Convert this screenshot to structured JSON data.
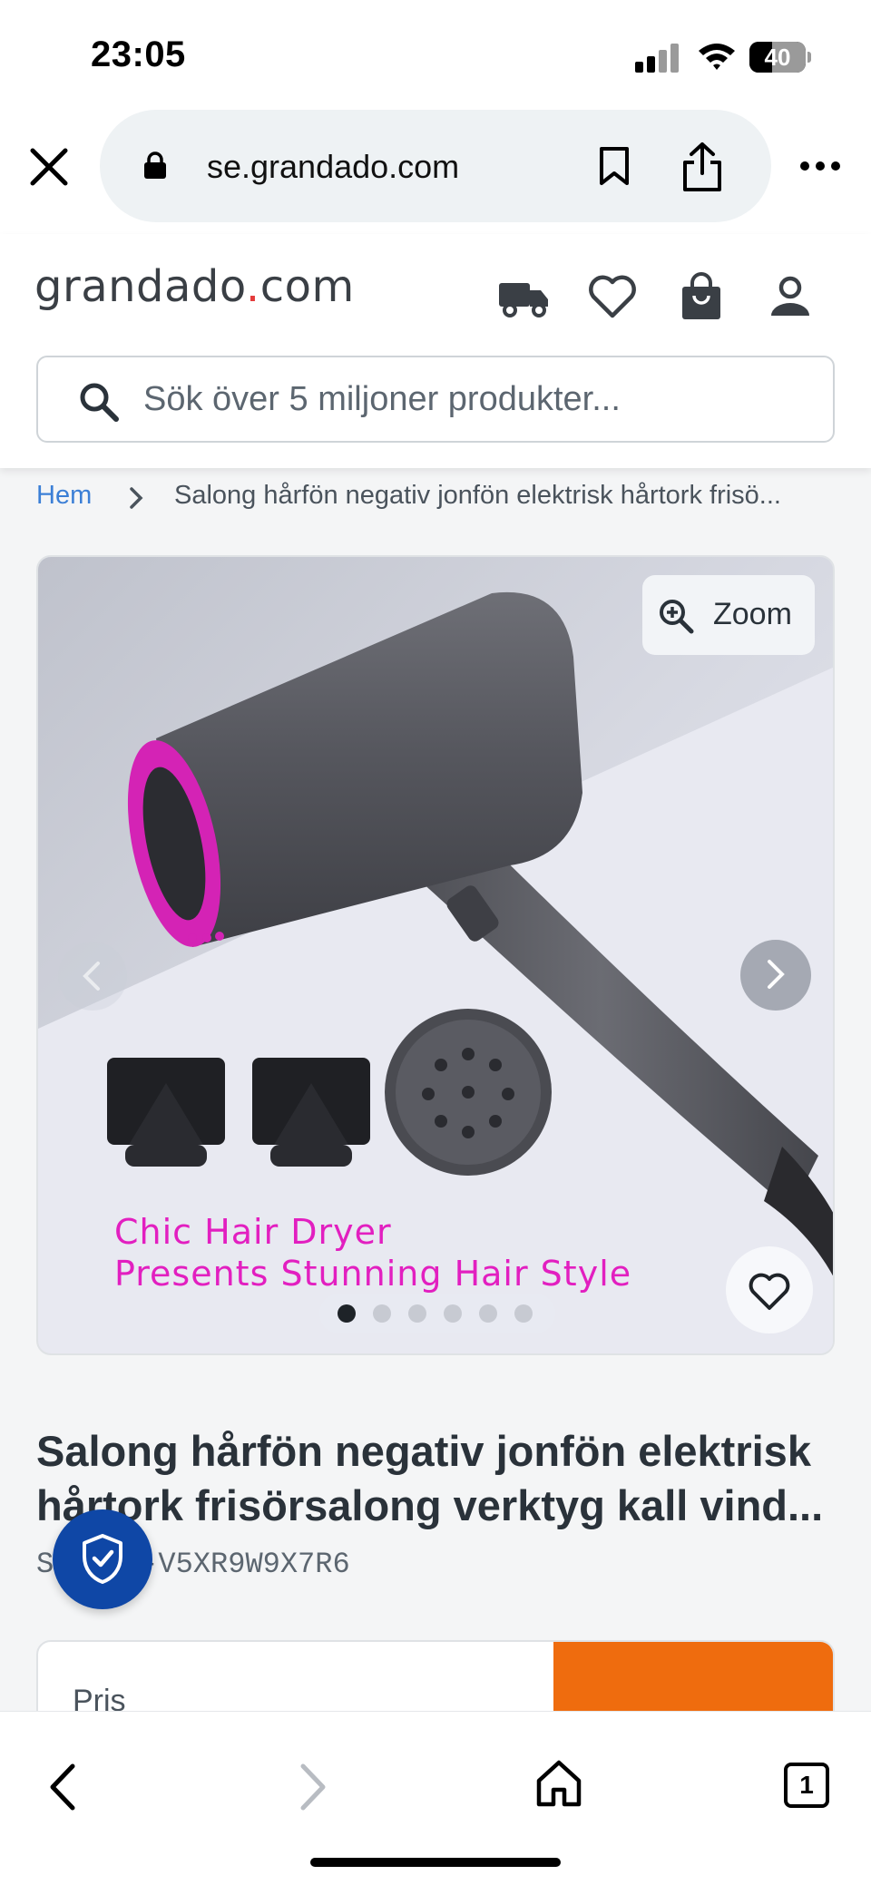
{
  "status_bar": {
    "time": "23:05",
    "battery": "40",
    "battery_level": 0.4
  },
  "browser": {
    "url": "se.grandado.com",
    "tab_count": "1"
  },
  "site": {
    "logo_main": "grandado",
    "logo_dot": ".",
    "logo_tld": "com",
    "search_placeholder": "Sök över 5 miljoner produkter..."
  },
  "breadcrumb": {
    "home": "Hem",
    "current": "Salong hårfön negativ jonfön elektrisk hårtork frisö..."
  },
  "gallery": {
    "zoom_label": "Zoom",
    "promo_line_1": "Chic Hair Dryer",
    "promo_line_2": "Presents Stunning Hair Style",
    "image_count": 6,
    "active_index": 0
  },
  "product": {
    "title_line_1": "Salong hårfön negativ jonfön elektrisk",
    "title_line_2": "hårtork frisörsalong verktyg kall vind...",
    "sku": "SKU AC-V5XR9W9X7R6",
    "price_label": "Pris"
  },
  "colors": {
    "accent_orange": "#ef6c0e",
    "link_blue": "#3b7fd6",
    "trust_blue": "#0f47a6",
    "logo_dot_red": "#e43b3b",
    "dryer_magenta": "#e21fc0"
  },
  "icons": [
    "close-icon",
    "lock-icon",
    "bookmark-icon",
    "share-icon",
    "more-icon",
    "truck-icon",
    "heart-icon",
    "shopping-bag-icon",
    "user-icon",
    "search-icon",
    "chevron-right-icon",
    "zoom-icon",
    "shield-check-icon",
    "back-icon",
    "forward-icon",
    "home-icon",
    "tabs-icon"
  ]
}
